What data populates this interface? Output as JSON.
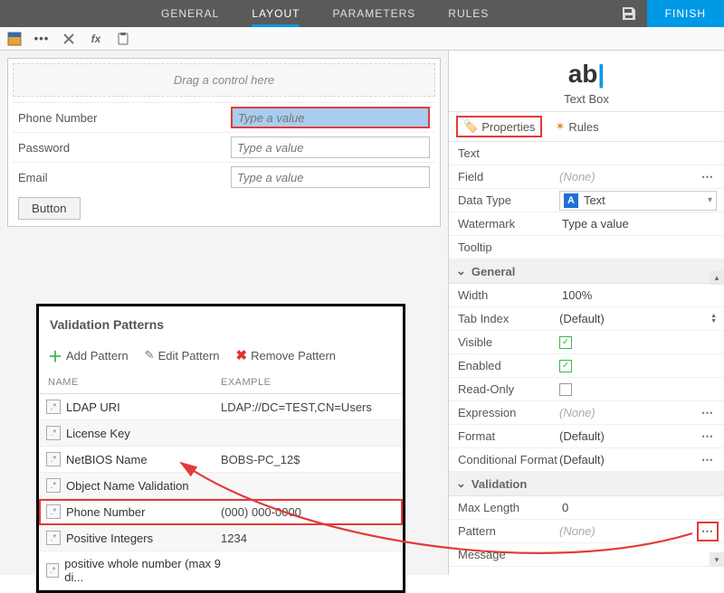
{
  "topbar": {
    "tabs": [
      "GENERAL",
      "LAYOUT",
      "PARAMETERS",
      "RULES"
    ],
    "finish": "FINISH"
  },
  "form": {
    "drag_hint": "Drag a control here",
    "rows": [
      {
        "label": "Phone Number",
        "placeholder": "Type a value",
        "selected": true
      },
      {
        "label": "Password",
        "placeholder": "Type a value",
        "selected": false
      },
      {
        "label": "Email",
        "placeholder": "Type a value",
        "selected": false
      }
    ],
    "button": "Button"
  },
  "vp": {
    "title": "Validation Patterns",
    "add": "Add Pattern",
    "edit": "Edit Pattern",
    "remove": "Remove Pattern",
    "head_name": "NAME",
    "head_example": "EXAMPLE",
    "rows": [
      {
        "name": "LDAP URI",
        "example": "LDAP://DC=TEST,CN=Users"
      },
      {
        "name": "License Key",
        "example": ""
      },
      {
        "name": "NetBIOS Name",
        "example": "BOBS-PC_12$"
      },
      {
        "name": "Object Name Validation",
        "example": ""
      },
      {
        "name": "Phone Number",
        "example": "(000) 000-0000",
        "selected": true
      },
      {
        "name": "Positive Integers",
        "example": "1234"
      },
      {
        "name": "positive whole number (max 9 di...",
        "example": ""
      }
    ]
  },
  "props": {
    "header_title": "Text Box",
    "tab_properties": "Properties",
    "tab_rules": "Rules",
    "text_label": "Text",
    "text_value": "",
    "field_label": "Field",
    "field_value": "(None)",
    "datatype_label": "Data Type",
    "datatype_value": "Text",
    "watermark_label": "Watermark",
    "watermark_value": "Type a value",
    "tooltip_label": "Tooltip",
    "tooltip_value": "",
    "grp_general": "General",
    "width_label": "Width",
    "width_value": "100%",
    "tabindex_label": "Tab Index",
    "tabindex_value": "(Default)",
    "visible_label": "Visible",
    "enabled_label": "Enabled",
    "readonly_label": "Read-Only",
    "expression_label": "Expression",
    "expression_value": "(None)",
    "format_label": "Format",
    "format_value": "(Default)",
    "condfmt_label": "Conditional Format",
    "condfmt_value": "(Default)",
    "grp_validation": "Validation",
    "maxlen_label": "Max Length",
    "maxlen_value": "0",
    "pattern_label": "Pattern",
    "pattern_value": "(None)",
    "message_label": "Message",
    "message_value": ""
  }
}
